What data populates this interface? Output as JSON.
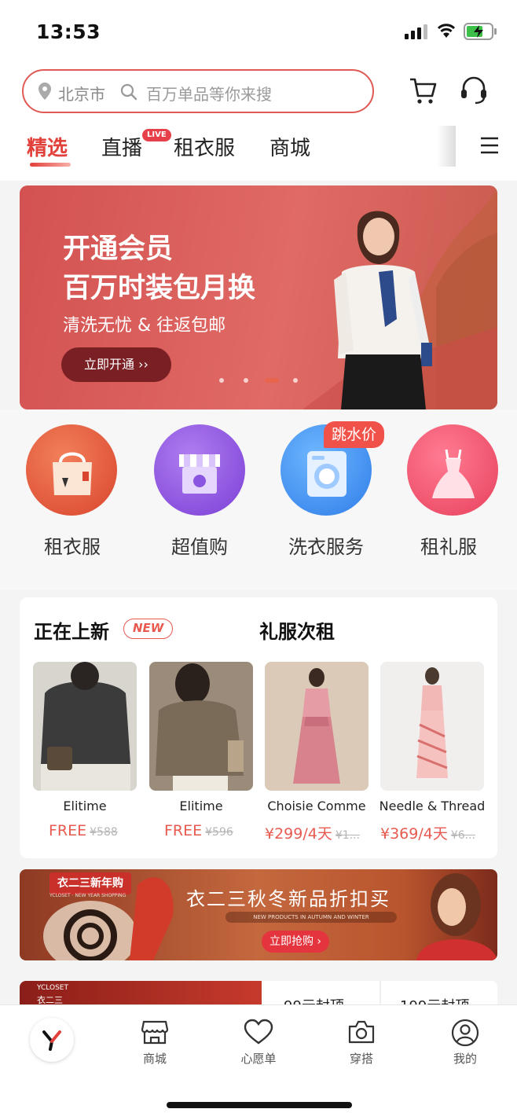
{
  "status_bar": {
    "time": "13:53"
  },
  "search": {
    "city": "北京市",
    "placeholder": "百万单品等你来搜"
  },
  "icons": {
    "cart": "cart-icon",
    "service": "headset-icon",
    "menu": "menu-icon"
  },
  "tabs": [
    {
      "label": "精选"
    },
    {
      "label": "直播",
      "badge": "LIVE"
    },
    {
      "label": "租衣服"
    },
    {
      "label": "商城"
    }
  ],
  "banner": {
    "title_line1": "开通会员",
    "title_line2": "百万时装包月换",
    "subtitle": "清洗无忧 & 往返包邮",
    "cta": "立即开通 ››",
    "page_count": 4,
    "active_page": 3
  },
  "categories": [
    {
      "label": "租衣服",
      "icon": "bag-icon"
    },
    {
      "label": "超值购",
      "icon": "shop-icon"
    },
    {
      "label": "洗衣服务",
      "icon": "washing-machine-icon",
      "tag": "跳水价"
    },
    {
      "label": "租礼服",
      "icon": "dress-icon"
    }
  ],
  "new_section": {
    "title": "正在上新",
    "badge": "NEW",
    "title2": "礼服次租",
    "products": [
      {
        "name": "Elitime",
        "price": "FREE",
        "old_price": "¥588"
      },
      {
        "name": "Elitime",
        "price": "FREE",
        "old_price": "¥596"
      },
      {
        "name": "Choisie Comme",
        "price": "¥299/4天",
        "old_price": "¥1..."
      },
      {
        "name": "Needle & Thread",
        "price": "¥369/4天",
        "old_price": "¥6..."
      }
    ]
  },
  "promo": {
    "tag": "衣二三新年购",
    "tag_sub": "YCLOSET · NEW YEAR SHOPPING",
    "title": "衣二三秋冬新品折扣买",
    "subtitle": "NEW PRODUCTS IN AUTUMN AND WINTER",
    "cta": "立即抢购 ›"
  },
  "peek": {
    "brand": "YCLOSET",
    "brand_cn": "衣二三",
    "item1": "99元封顶",
    "item2": "199元封顶"
  },
  "tabbar": [
    {
      "label": "",
      "icon": "logo-icon"
    },
    {
      "label": "商城",
      "icon": "store-icon"
    },
    {
      "label": "心愿单",
      "icon": "heart-icon"
    },
    {
      "label": "穿搭",
      "icon": "camera-icon"
    },
    {
      "label": "我的",
      "icon": "user-icon"
    }
  ],
  "colors": {
    "accent": "#e2403a",
    "price": "#e85a50",
    "banner": "#d35251"
  }
}
